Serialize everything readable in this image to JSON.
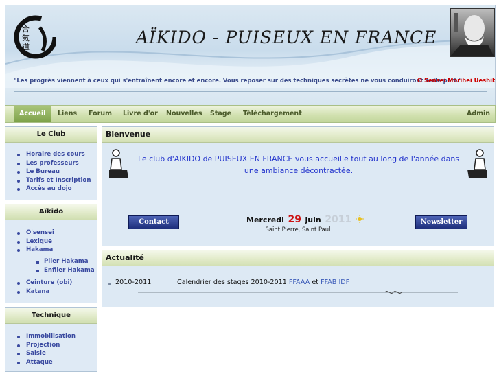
{
  "header": {
    "title": "AÏKIDO - PUISEUX EN FRANCE",
    "logo_icon": "aikido-calligraphy-logo",
    "portrait_icon": "o-sensei-portrait",
    "quote": "\"Les progrès viennent à ceux qui s'entraînent encore et encore. Vous reposer sur des techniques secrètes ne vous conduiront nulle part.\"",
    "quote_author": "O Sensei Morihei Ueshiba"
  },
  "nav": {
    "items": [
      "Accueil",
      "Liens",
      "Forum",
      "Livre d'or",
      "Nouvelles",
      "Stage",
      "Téléchargement"
    ],
    "admin": "Admin"
  },
  "sidebar": {
    "club": {
      "title": "Le Club",
      "items": [
        "Horaire des cours",
        "Les professeurs",
        "Le Bureau",
        "Tarifs et Inscription",
        "Accès au dojo"
      ]
    },
    "aikido": {
      "title": "Aïkido",
      "items": [
        "O'sensei",
        "Lexique",
        "Hakama"
      ],
      "sub": [
        "Plier Hakama",
        "Enfiler Hakama"
      ],
      "items2": [
        "Ceinture (obi)",
        "Katana"
      ]
    },
    "technique": {
      "title": "Technique",
      "items": [
        "Immobilisation",
        "Projection",
        "Saisie",
        "Attaque"
      ]
    }
  },
  "bienvenue": {
    "title": "Bienvenue",
    "text": "Le club d'AIKIDO de PUISEUX EN FRANCE vous accueille tout au long de l'année dans une ambiance décontractée.",
    "contact": "Contact",
    "newsletter": "Newsletter",
    "date": {
      "day": "Mercredi",
      "num": "29",
      "month": "juin",
      "year": "2011"
    },
    "saints": "Saint Pierre, Saint Paul"
  },
  "actualite": {
    "title": "Actualité",
    "year": "2010-2011",
    "text": "Calendrier des stages 2010-2011",
    "link1": "FFAAA",
    "and": "et",
    "link2": "FFAB IDF"
  },
  "colors": {
    "link": "#3a4aa0",
    "accent_red": "#cc0000",
    "nav_active": "#7ea24a"
  }
}
